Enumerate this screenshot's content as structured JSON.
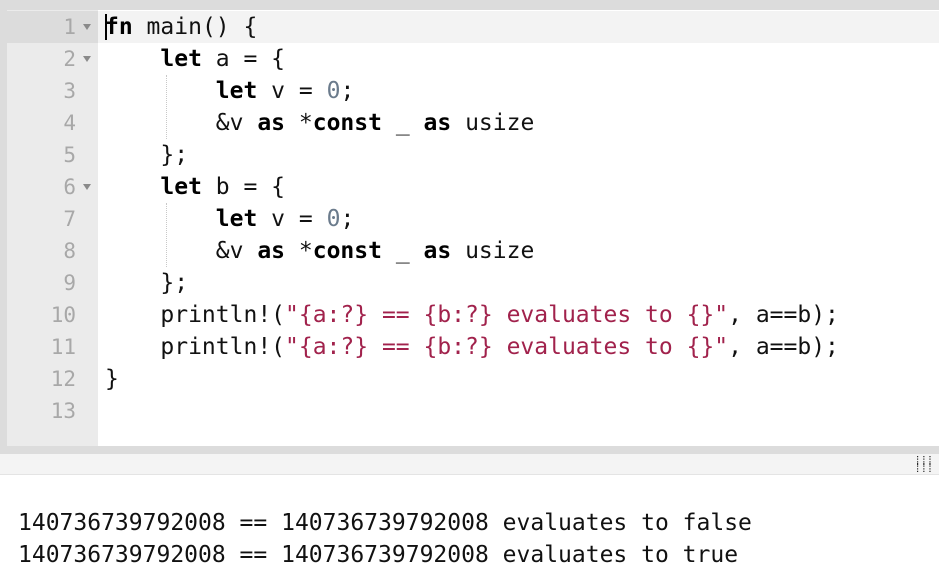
{
  "editor": {
    "line_numbers": [
      "1",
      "2",
      "3",
      "4",
      "5",
      "6",
      "7",
      "8",
      "9",
      "10",
      "11",
      "12",
      "13"
    ],
    "fold_lines": [
      "1",
      "2",
      "6"
    ],
    "lines": [
      [
        {
          "t": "fn",
          "k": "kw"
        },
        {
          "t": " main() {",
          "k": "p"
        }
      ],
      [
        {
          "t": "    ",
          "k": "p"
        },
        {
          "t": "let",
          "k": "kw"
        },
        {
          "t": " a = {",
          "k": "p"
        }
      ],
      [
        {
          "t": "        ",
          "k": "p"
        },
        {
          "t": "let",
          "k": "kw"
        },
        {
          "t": " v = ",
          "k": "p"
        },
        {
          "t": "0",
          "k": "num"
        },
        {
          "t": ";",
          "k": "p"
        }
      ],
      [
        {
          "t": "        &v ",
          "k": "p"
        },
        {
          "t": "as",
          "k": "kw"
        },
        {
          "t": " *",
          "k": "p"
        },
        {
          "t": "const",
          "k": "kw"
        },
        {
          "t": " _ ",
          "k": "p"
        },
        {
          "t": "as",
          "k": "kw"
        },
        {
          "t": " usize",
          "k": "p"
        }
      ],
      [
        {
          "t": "    };",
          "k": "p"
        }
      ],
      [
        {
          "t": "    ",
          "k": "p"
        },
        {
          "t": "let",
          "k": "kw"
        },
        {
          "t": " b = {",
          "k": "p"
        }
      ],
      [
        {
          "t": "        ",
          "k": "p"
        },
        {
          "t": "let",
          "k": "kw"
        },
        {
          "t": " v = ",
          "k": "p"
        },
        {
          "t": "0",
          "k": "num"
        },
        {
          "t": ";",
          "k": "p"
        }
      ],
      [
        {
          "t": "        &v ",
          "k": "p"
        },
        {
          "t": "as",
          "k": "kw"
        },
        {
          "t": " *",
          "k": "p"
        },
        {
          "t": "const",
          "k": "kw"
        },
        {
          "t": " _ ",
          "k": "p"
        },
        {
          "t": "as",
          "k": "kw"
        },
        {
          "t": " usize",
          "k": "p"
        }
      ],
      [
        {
          "t": "    };",
          "k": "p"
        }
      ],
      [
        {
          "t": "    println!(",
          "k": "p"
        },
        {
          "t": "\"{a:?} == {b:?} evaluates to {}\"",
          "k": "str"
        },
        {
          "t": ", a==b);",
          "k": "p"
        }
      ],
      [
        {
          "t": "    println!(",
          "k": "p"
        },
        {
          "t": "\"{a:?} == {b:?} evaluates to {}\"",
          "k": "str"
        },
        {
          "t": ", a==b);",
          "k": "p"
        }
      ],
      [
        {
          "t": "}",
          "k": "p"
        }
      ],
      []
    ]
  },
  "output": {
    "lines": [
      "140736739792008 == 140736739792008 evaluates to false",
      "140736739792008 == 140736739792008 evaluates to true"
    ]
  },
  "icons": {
    "resize_grip": "resize-grip-icon",
    "fold": "fold-arrow-icon"
  },
  "colors": {
    "keyword": "#000000",
    "string": "#a1224c",
    "number": "#6b7b8c",
    "gutter_text": "#a8a8a8"
  }
}
